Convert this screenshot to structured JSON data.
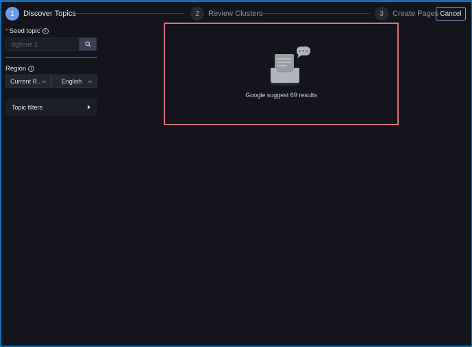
{
  "stepper": {
    "steps": [
      {
        "number": "1",
        "label": "Discover Topics"
      },
      {
        "number": "2",
        "label": "Review Clusters"
      },
      {
        "number": "3",
        "label": "Create Pages"
      }
    ],
    "cancel_label": "Cancel"
  },
  "sidebar": {
    "seed_topic": {
      "required_mark": "*",
      "label": "Seed topic",
      "placeholder": "digitone 2"
    },
    "region": {
      "label": "Region",
      "region_value": "Current R...",
      "language_value": "English"
    },
    "topic_filters_label": "Topic filters"
  },
  "results": {
    "text": "Google suggest 69 results"
  },
  "colors": {
    "accent": "#6f9bea",
    "highlight_border": "#d9727a",
    "background": "#14151c"
  },
  "icons": [
    "info-icon",
    "search-icon",
    "chevron-down-icon",
    "caret-right-icon",
    "empty-inbox-icon",
    "chat-bubble-icon"
  ]
}
